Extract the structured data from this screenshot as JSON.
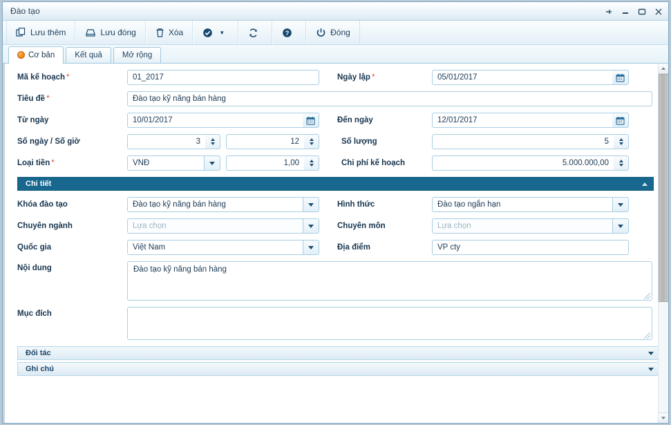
{
  "window": {
    "title": "Đào tạo",
    "controls": [
      {
        "name": "pin-icon",
        "label": "Pin"
      },
      {
        "name": "minimize-icon",
        "label": "Minimize"
      },
      {
        "name": "maximize-icon",
        "label": "Maximize"
      },
      {
        "name": "close-icon",
        "label": "Close"
      }
    ]
  },
  "toolbar": {
    "save_add_label": "Lưu thêm",
    "save_close_label": "Lưu đóng",
    "delete_label": "Xóa",
    "approve_label": "",
    "refresh_label": "",
    "help_label": "",
    "close_label": "Đóng",
    "icons": {
      "save_add": "copy-icon",
      "save_close": "disk-icon",
      "delete": "trash-icon",
      "approve": "check-circle-icon",
      "approve_caret": "chevron-down-icon",
      "refresh": "refresh-icon",
      "help": "question-circle-icon",
      "close": "power-icon"
    }
  },
  "tabs": [
    {
      "label": "Cơ bản",
      "active": true
    },
    {
      "label": "Kết quả",
      "active": false
    },
    {
      "label": "Mở rộng",
      "active": false
    }
  ],
  "form": {
    "ma_ke_hoach": {
      "label": "Mã kế hoạch",
      "required": true,
      "value": "01_2017"
    },
    "ngay_lap": {
      "label": "Ngày lập",
      "required": true,
      "value": "05/01/2017"
    },
    "tieu_de": {
      "label": "Tiêu đề",
      "required": true,
      "value": "Đào tạo kỹ năng bán hàng"
    },
    "tu_ngay": {
      "label": "Từ ngày",
      "required": false,
      "value": "10/01/2017"
    },
    "den_ngay": {
      "label": "Đến ngày",
      "required": false,
      "value": "12/01/2017"
    },
    "so_ngay_so_gio": {
      "label": "Số ngày / Số giờ",
      "required": false,
      "so_ngay": "3",
      "so_gio": "12"
    },
    "so_luong": {
      "label": "Số lượng",
      "required": false,
      "value": "5"
    },
    "loai_tien": {
      "label": "Loại tiền",
      "required": true,
      "value": "VNĐ",
      "ty_gia": "1,00"
    },
    "chi_phi_ke_hoach": {
      "label": "Chi phí kế hoạch",
      "required": false,
      "value": "5.000.000,00"
    }
  },
  "detail_section": {
    "title": "Chi tiết",
    "collapse_icon": "chevron-up-icon",
    "khoa_dao_tao": {
      "label": "Khóa đào tạo",
      "value": "Đào tạo kỹ năng bán hàng"
    },
    "hinh_thuc": {
      "label": "Hình thức",
      "value": "Đào tạo ngắn hạn"
    },
    "chuyen_nganh": {
      "label": "Chuyên ngành",
      "value": "",
      "placeholder": "Lựa chọn"
    },
    "chuyen_mon": {
      "label": "Chuyên môn",
      "value": "",
      "placeholder": "Lựa chọn"
    },
    "quoc_gia": {
      "label": "Quốc gia",
      "value": "Việt Nam"
    },
    "dia_diem": {
      "label": "Địa điểm",
      "value": "VP cty"
    },
    "noi_dung": {
      "label": "Nội dung",
      "value": "Đào tạo kỹ năng bán hàng"
    },
    "muc_dich": {
      "label": "Mục đích",
      "value": ""
    }
  },
  "collapsed_sections": [
    {
      "title": "Đối tác",
      "expand_icon": "chevron-down-icon"
    },
    {
      "title": "Ghi chú",
      "expand_icon": "chevron-down-icon"
    }
  ],
  "colors": {
    "section_header_bg": "#17678f",
    "accent_border": "#a8cde3",
    "required_star": "#e04b3c",
    "tab_dot": "#f08a1e",
    "label_text": "#16344e"
  }
}
